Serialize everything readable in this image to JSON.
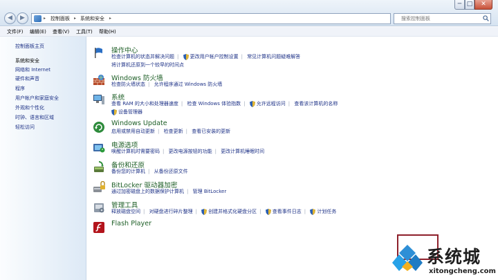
{
  "window": {
    "min": "─",
    "max": "□",
    "close": "✕"
  },
  "nav": {
    "back": "◀",
    "forward": "▶"
  },
  "address": {
    "segments": [
      "控制面板",
      "系统和安全"
    ],
    "chev": "▸"
  },
  "search": {
    "placeholder": "搜索控制面板"
  },
  "menu": [
    "文件(F)",
    "编辑(E)",
    "查看(V)",
    "工具(T)",
    "帮助(H)"
  ],
  "sidebar": {
    "items": [
      "控制面板主页",
      "系统和安全",
      "网络和 Internet",
      "硬件和声音",
      "程序",
      "用户帐户和家庭安全",
      "外观和个性化",
      "时钟、语言和区域",
      "轻松访问"
    ]
  },
  "categories": [
    {
      "title": "操作中心",
      "lines": [
        [
          "检查计算机的状态并解决问题",
          "更改用户帐户控制设置",
          "常见计算机问题疑难解答"
        ],
        [
          "将计算机还原到一个较早的时间点"
        ]
      ]
    },
    {
      "title": "Windows 防火墙",
      "lines": [
        [
          "检查防火墙状态",
          "允许程序通过 Windows 防火墙"
        ]
      ]
    },
    {
      "title": "系统",
      "lines": [
        [
          "查看 RAM 的大小和处理器速度",
          "检查 Windows 体验指数",
          "允许远程访问",
          "查看该计算机的名称"
        ],
        [
          "设备管理器"
        ]
      ]
    },
    {
      "title": "Windows Update",
      "lines": [
        [
          "启用或禁用自动更新",
          "检查更新",
          "查看已安装的更新"
        ]
      ]
    },
    {
      "title": "电源选项",
      "lines": [
        [
          "唤醒计算机时需要密码",
          "更改电源按钮的功能",
          "更改计算机睡眠时间"
        ]
      ]
    },
    {
      "title": "备份和还原",
      "lines": [
        [
          "备份您的计算机",
          "从备份还原文件"
        ]
      ]
    },
    {
      "title": "BitLocker 驱动器加密",
      "lines": [
        [
          "通过加密磁盘上的数据保护计算机",
          "管理 BitLocker"
        ]
      ]
    },
    {
      "title": "管理工具",
      "lines": [
        [
          "释放磁盘空间",
          "对硬盘进行碎片整理",
          "创建并格式化硬盘分区",
          "查看事件日志",
          "计划任务"
        ]
      ]
    },
    {
      "title": "Flash Player",
      "lines": []
    }
  ],
  "watermark": {
    "text": "系统城",
    "url": "xitongcheng.com"
  },
  "colors": {
    "accent": "#1e3287",
    "title_green": "#1d5e26",
    "highlight_border": "#8d1f2a"
  }
}
